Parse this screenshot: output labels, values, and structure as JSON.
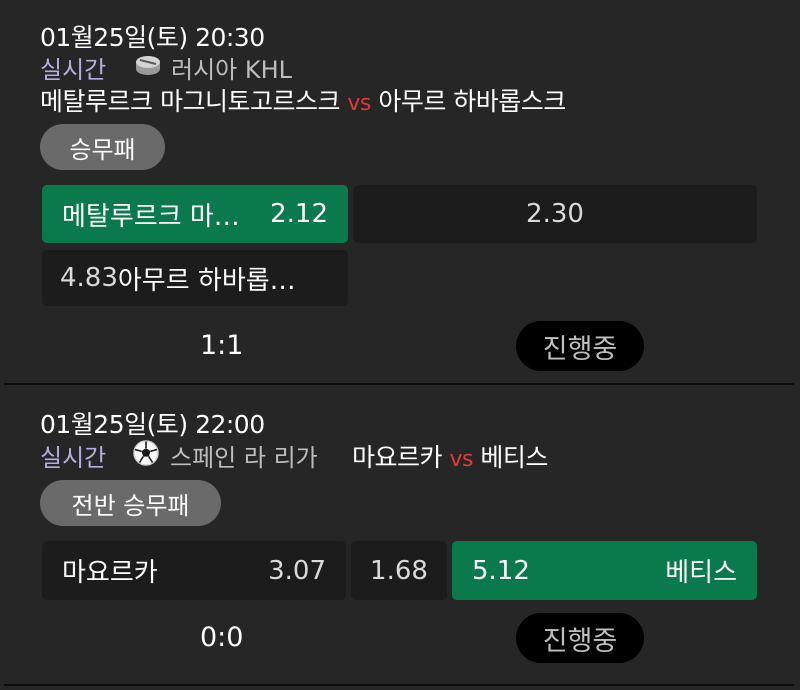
{
  "matches": [
    {
      "datetime": "01월25일(토) 20:30",
      "status_live": "실시간",
      "sport_icon": "hockey-puck-icon",
      "league": "러시아 KHL",
      "home": "메탈루르크 마그니토고르스크",
      "vs": "vs",
      "away": "아무르 하바롭스크",
      "market": "승무패",
      "odds": {
        "home_name": "메탈루르크 마…",
        "home": "2.12",
        "draw": "2.30",
        "away": "4.83",
        "away_name": "아무르 하바롭…"
      },
      "score": "1:1",
      "state": "진행중"
    },
    {
      "datetime": "01월25일(토) 22:00",
      "status_live": "실시간",
      "sport_icon": "soccer-ball-icon",
      "league": "스페인 라 리가",
      "home": "마요르카",
      "vs": "vs",
      "away": "베티스",
      "market": "전반 승무패",
      "odds": {
        "home_name": "마요르카",
        "home": "3.07",
        "draw": "1.68",
        "away": "5.12",
        "away_name": "베티스"
      },
      "score": "0:0",
      "state": "진행중"
    }
  ],
  "colors": {
    "background": "#262626",
    "live": "#b4aee0",
    "vs": "#e23a3a",
    "selected": "#0a7a4d",
    "odds_box": "#1c1c1c",
    "market_pill": "#6a6a6a"
  }
}
